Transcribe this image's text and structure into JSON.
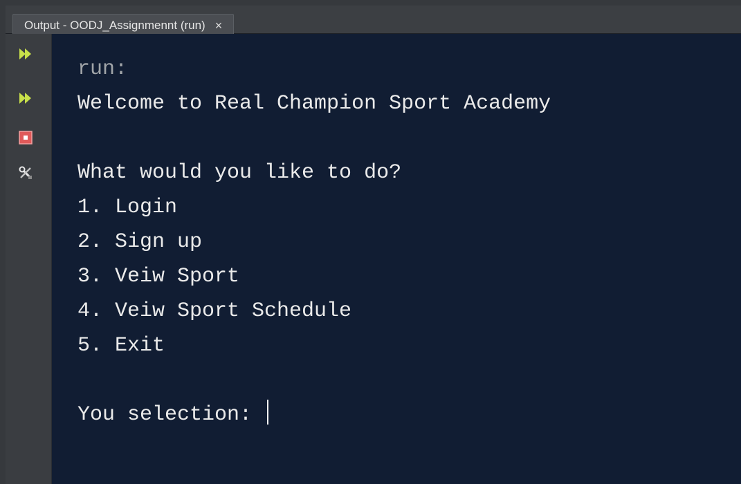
{
  "window": {
    "tab_title": "Output - OODJ_Assignmennt (run)",
    "tab_close": "×"
  },
  "toolbar": {
    "items": [
      {
        "icon": "rerun-icon",
        "color": "#c8e04a"
      },
      {
        "icon": "rerun-with-options-icon",
        "color": "#c8e04a"
      },
      {
        "icon": "stop-icon",
        "color": "#e05555"
      },
      {
        "icon": "settings-icon",
        "color": "#e0e0e0"
      }
    ]
  },
  "console": {
    "lines": [
      "run:",
      "Welcome to Real Champion Sport Academy",
      "",
      "What would you like to do?",
      "1. Login",
      "2. Sign up",
      "3. Veiw Sport",
      "4. Veiw Sport Schedule",
      "5. Exit",
      "",
      "You selection: "
    ],
    "background": "#111d33",
    "text_color": "#eaeaea"
  }
}
